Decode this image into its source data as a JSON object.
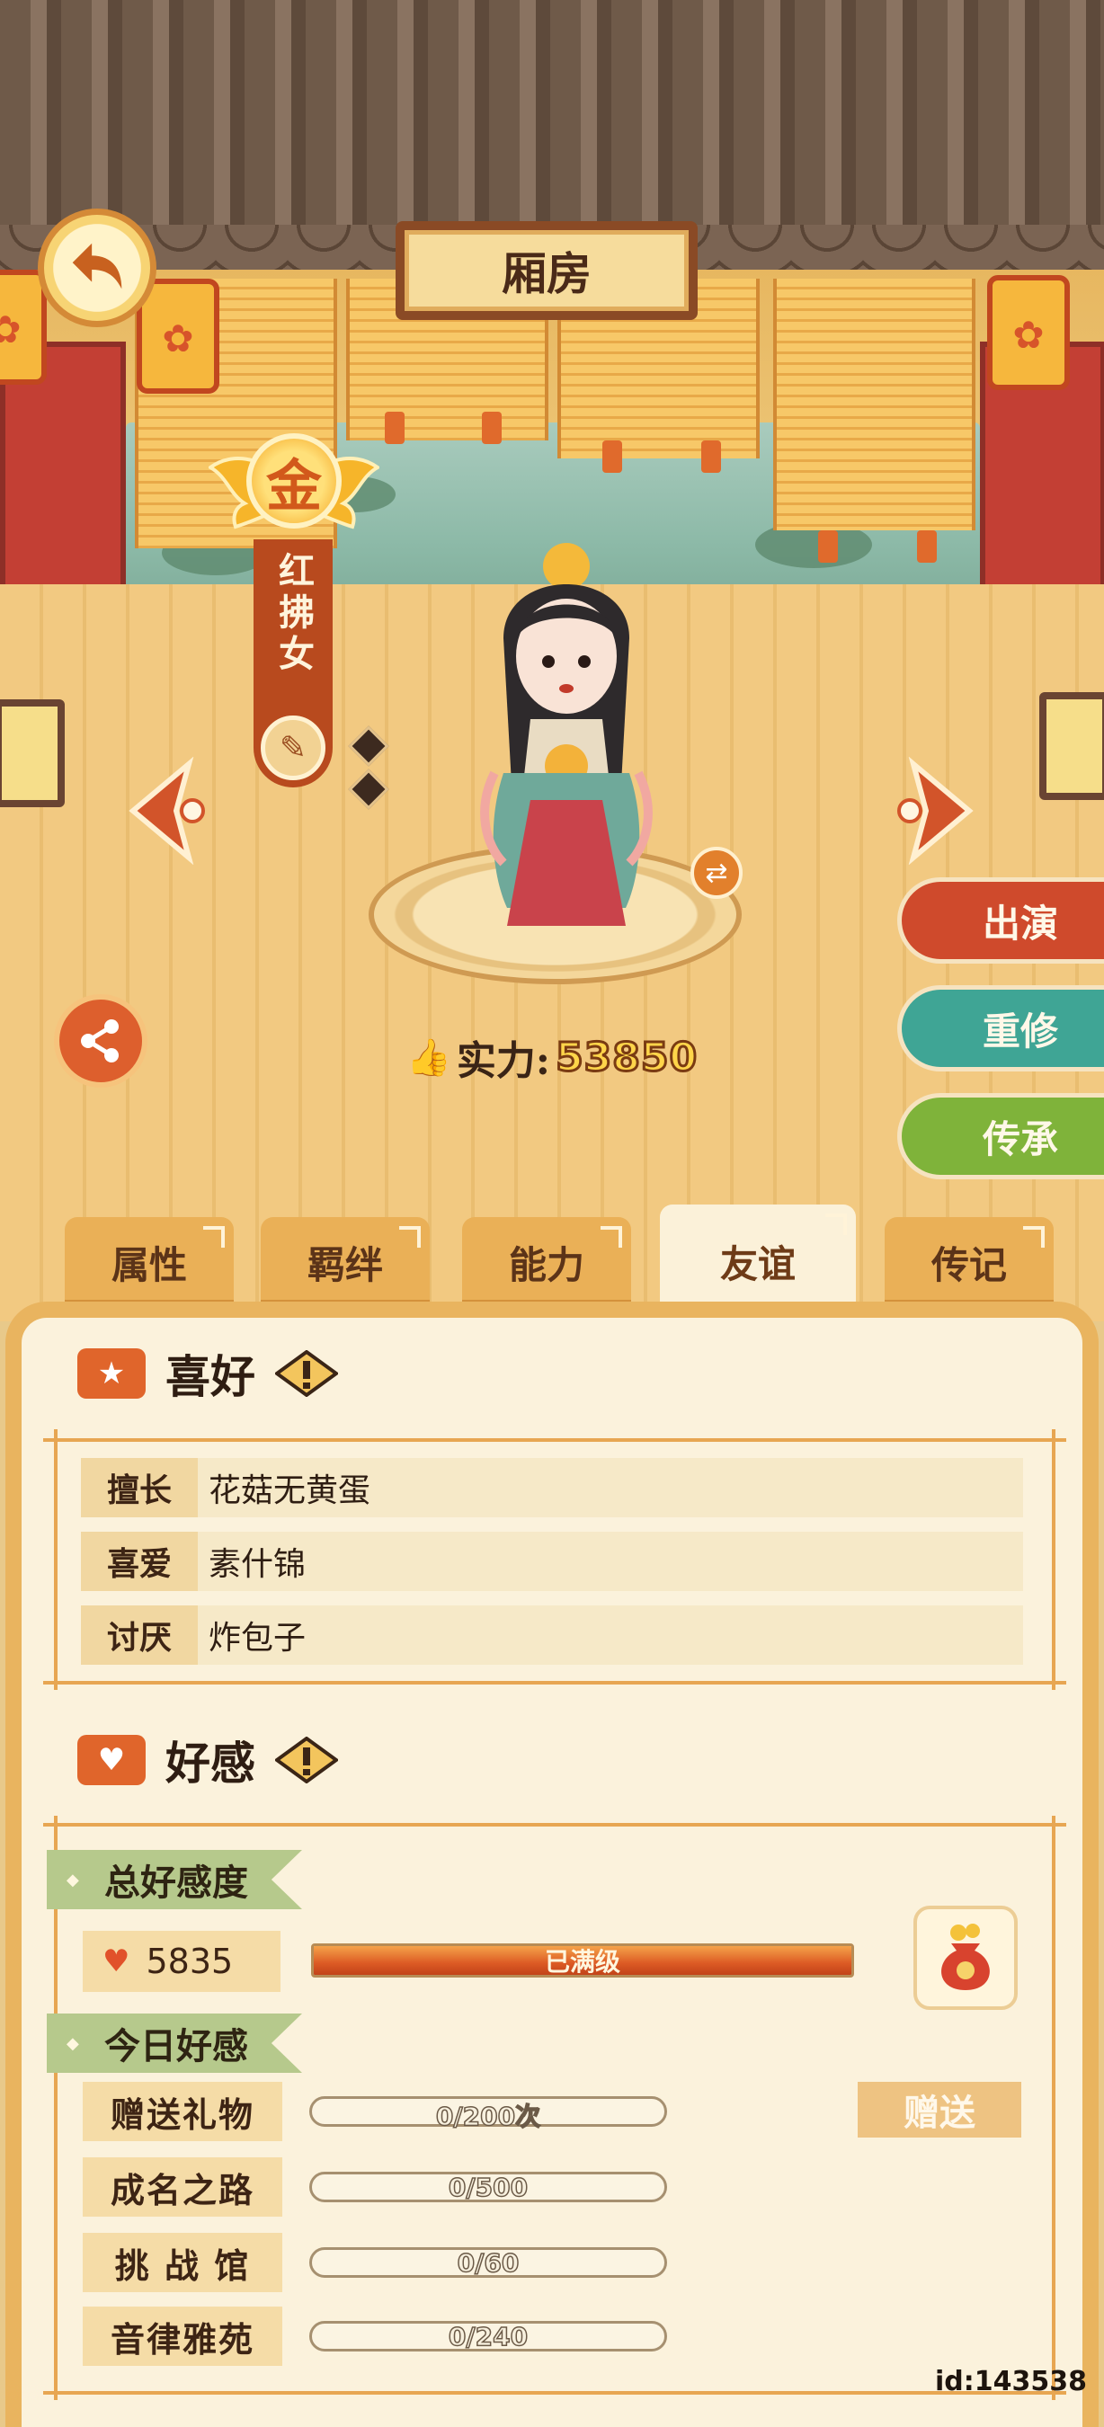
{
  "header": {
    "title": "厢房"
  },
  "character": {
    "rank": "金",
    "name": "红拂女"
  },
  "power": {
    "label": "实力:",
    "value": "53850"
  },
  "side_buttons": {
    "perform": "出演",
    "retrain": "重修",
    "inherit": "传承"
  },
  "tabs": [
    {
      "label": "属性",
      "active": false
    },
    {
      "label": "羁绊",
      "active": false
    },
    {
      "label": "能力",
      "active": false
    },
    {
      "label": "友谊",
      "active": true
    },
    {
      "label": "传记",
      "active": false
    }
  ],
  "hobby": {
    "title": "喜好",
    "rows": [
      {
        "key": "擅长",
        "value": "花菇无黄蛋"
      },
      {
        "key": "喜爱",
        "value": "素什锦"
      },
      {
        "key": "讨厌",
        "value": "炸包子"
      }
    ]
  },
  "favor": {
    "title": "好感",
    "total_label": "总好感度",
    "total_value": "5835",
    "total_progress": 1.0,
    "total_bar_text": "已满级",
    "today_label": "今日好感",
    "tasks": [
      {
        "label": "赠送礼物",
        "progress": "0/200次"
      },
      {
        "label": "成名之路",
        "progress": "0/500"
      },
      {
        "label": "挑 战 馆",
        "progress": "0/60"
      },
      {
        "label": "音律雅苑",
        "progress": "0/240"
      }
    ],
    "give_button": "赠送"
  },
  "id_tag": "id:143538",
  "colors": {
    "perform_btn": "#cf4a2c",
    "retrain_btn": "#3fa595",
    "inherit_btn": "#7fb33a",
    "panel_bg": "#fbf2dc",
    "panel_border": "#e9b45f"
  },
  "icons": {
    "back": "back-arrow-icon",
    "share": "share-icon",
    "brush": "brush-icon",
    "swap": "swap-icon",
    "gift": "gift-bag-icon"
  }
}
